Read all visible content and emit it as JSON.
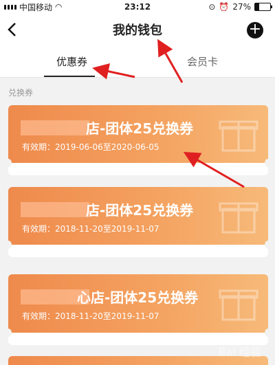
{
  "status_bar": {
    "carrier": "中国移动",
    "time": "23:12",
    "battery": "27%",
    "battery_level": 0.27
  },
  "nav": {
    "title": "我的钱包"
  },
  "tabs": [
    {
      "label": "优惠券",
      "active": true
    },
    {
      "label": "会员卡",
      "active": false
    }
  ],
  "section": {
    "label": "兑换券"
  },
  "coupons": [
    {
      "title": "店-团体25兑换券",
      "validity": "有效期：2019-06-06至2020-06-05"
    },
    {
      "title": "店-团体25兑换券",
      "validity": "有效期：2018-11-20至2019-11-07"
    },
    {
      "title": "心店-团体25兑换券",
      "validity": "有效期：2018-11-20至2019-11-07"
    }
  ],
  "watermark": "Bai 经验"
}
